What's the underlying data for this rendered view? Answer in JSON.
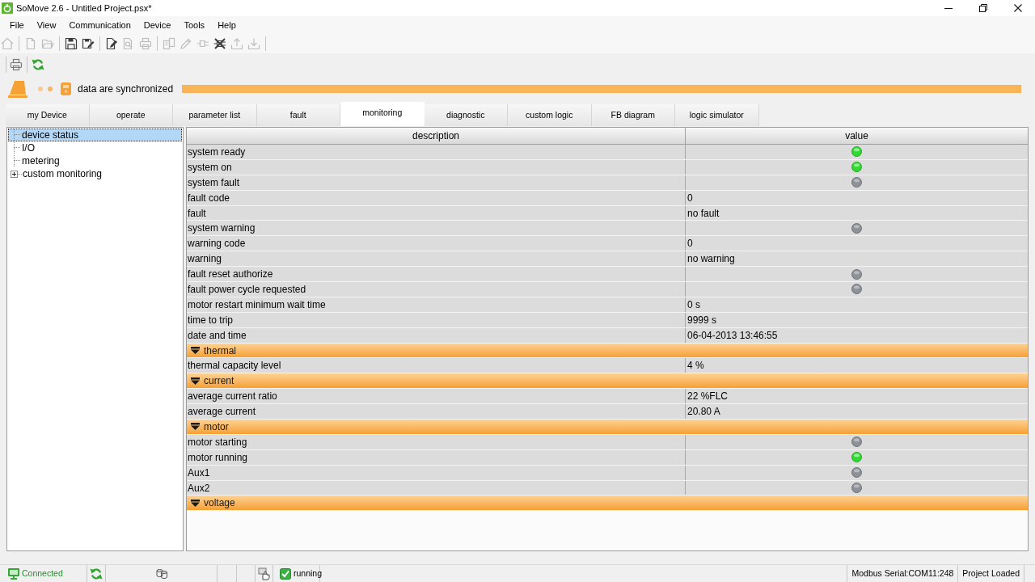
{
  "window": {
    "title": "SoMove 2.6 - Untitled Project.psx*"
  },
  "menu": [
    "File",
    "View",
    "Communication",
    "Device",
    "Tools",
    "Help"
  ],
  "toolbar": [
    [
      {
        "disabled": true
      }
    ],
    [
      {
        "disabled": true
      },
      {
        "disabled": true
      }
    ],
    [
      {
        "disabled": false
      },
      {
        "disabled": false
      }
    ],
    [
      {
        "disabled": false
      },
      {
        "disabled": true
      },
      {
        "disabled": true
      }
    ],
    [
      {
        "disabled": true
      },
      {
        "disabled": true
      },
      {
        "disabled": true
      },
      {
        "disabled": false
      },
      {
        "disabled": true
      },
      {
        "disabled": true
      }
    ]
  ],
  "toolbar_2": [
    [
      {
        "disabled": false
      }
    ],
    [
      {
        "disabled": false
      }
    ]
  ],
  "sync": {
    "text": "data are synchronized"
  },
  "tabs": [
    {
      "label": "my Device",
      "selected": false
    },
    {
      "label": "operate",
      "selected": false
    },
    {
      "label": "parameter list",
      "selected": false
    },
    {
      "label": "fault",
      "selected": false
    },
    {
      "label": "monitoring",
      "selected": true
    },
    {
      "label": "diagnostic",
      "selected": false
    },
    {
      "label": "custom logic",
      "selected": false
    },
    {
      "label": "FB diagram",
      "selected": false
    },
    {
      "label": "logic simulator",
      "selected": false
    }
  ],
  "tree": {
    "items": [
      {
        "kind": "leaf",
        "label": "device status",
        "selected": true
      },
      {
        "kind": "leaf",
        "label": "I/O",
        "selected": false
      },
      {
        "kind": "leaf",
        "label": "metering",
        "selected": false
      },
      {
        "kind": "group",
        "label": "custom monitoring",
        "selected": false,
        "expanded": false
      }
    ]
  },
  "table": {
    "columns": [
      "description",
      "value"
    ],
    "rows": [
      {
        "kind": "led",
        "description": "system ready",
        "on": true
      },
      {
        "kind": "led",
        "description": "system on",
        "on": true
      },
      {
        "kind": "led",
        "description": "system fault",
        "on": false
      },
      {
        "kind": "text",
        "description": "fault code",
        "value": "0"
      },
      {
        "kind": "text",
        "description": "fault",
        "value": "no fault"
      },
      {
        "kind": "led",
        "description": "system warning",
        "on": false
      },
      {
        "kind": "text",
        "description": "warning code",
        "value": "0"
      },
      {
        "kind": "text",
        "description": "warning",
        "value": "no warning"
      },
      {
        "kind": "led",
        "description": "fault reset authorize",
        "on": false
      },
      {
        "kind": "led",
        "description": "fault power cycle requested",
        "on": false
      },
      {
        "kind": "text",
        "description": "motor restart minimum wait time",
        "value": "0 s"
      },
      {
        "kind": "text",
        "description": "time to trip",
        "value": "9999 s"
      },
      {
        "kind": "text",
        "description": "date and time",
        "value": "06-04-2013 13:46:55"
      },
      {
        "kind": "section",
        "label": "thermal",
        "expanded": true
      },
      {
        "kind": "text",
        "description": "thermal capacity level",
        "value": "4 %"
      },
      {
        "kind": "section",
        "label": "current",
        "expanded": true
      },
      {
        "kind": "text",
        "description": "average current ratio",
        "value": "22 %FLC"
      },
      {
        "kind": "text",
        "description": "average current",
        "value": "20.80 A"
      },
      {
        "kind": "section",
        "label": "motor",
        "expanded": true
      },
      {
        "kind": "led",
        "description": "motor starting",
        "on": false
      },
      {
        "kind": "led",
        "description": "motor running",
        "on": true
      },
      {
        "kind": "led",
        "description": "Aux1",
        "on": false
      },
      {
        "kind": "led",
        "description": "Aux2",
        "on": false
      },
      {
        "kind": "section",
        "label": "voltage",
        "expanded": true
      }
    ]
  },
  "status_bar": {
    "connection": "Connected",
    "run_state": "running",
    "port": "Modbus Serial:COM11:248",
    "project": "Project Loaded"
  }
}
